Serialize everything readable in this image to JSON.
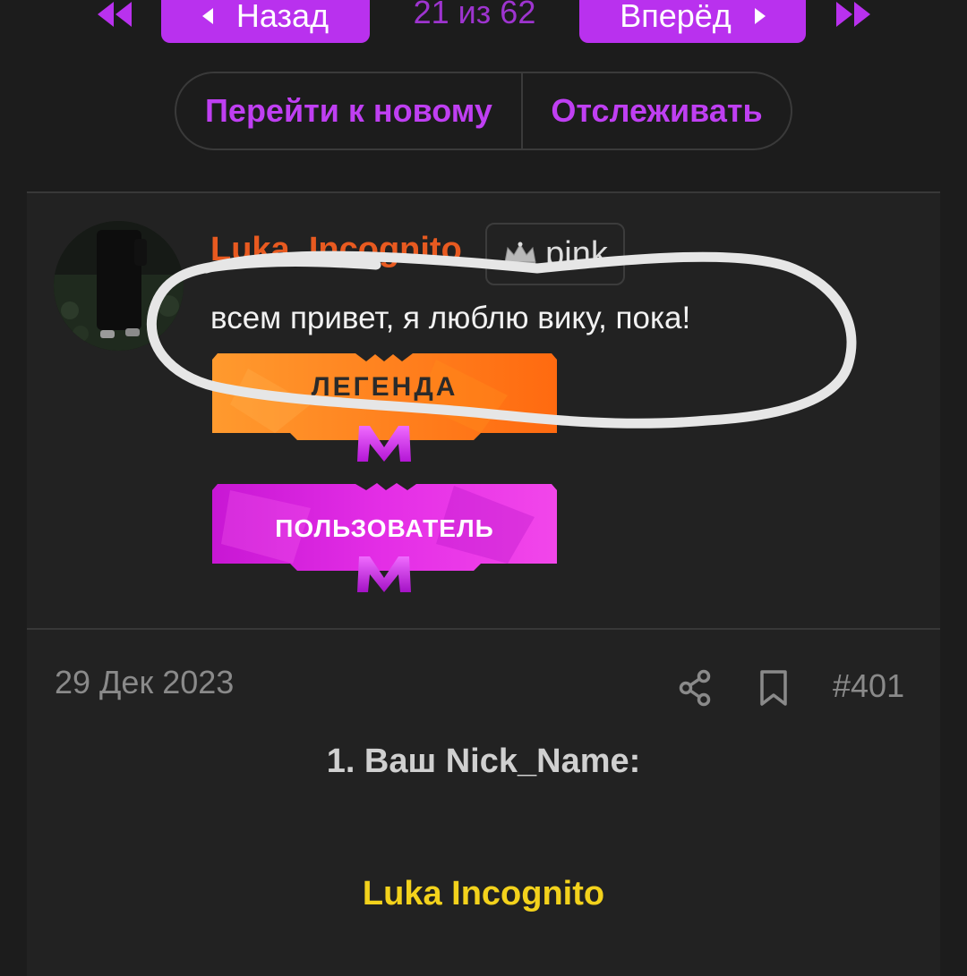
{
  "pagination": {
    "prev_label": "Назад",
    "next_label": "Вперёд",
    "counter": "21 из 62",
    "accent_color": "#b931ee"
  },
  "thread_actions": {
    "goto_new_label": "Перейти к новому",
    "watch_label": "Отслеживать"
  },
  "post": {
    "author": "Luka_Incognito",
    "title_badge": {
      "icon": "crown-icon",
      "label": "pink"
    },
    "status_text": "всем привет, я люблю вику, пока!",
    "rank_banners": [
      {
        "label": "ЛЕГЕНДА",
        "icon": "m-logo-icon",
        "color": "#ff7a1a"
      },
      {
        "label": "ПОЛЬЗОВАТЕЛЬ",
        "icon": "m-logo-icon",
        "color": "#e01ee6"
      }
    ],
    "date": "29 Дек 2023",
    "number": "#401",
    "actions": [
      "share-icon",
      "bookmark-icon"
    ],
    "body": {
      "question": "1. Ваш Nick_Name:",
      "answer": "Luka Incognito",
      "answer_color": "#f3d21c"
    },
    "author_color": "#e85a20"
  }
}
